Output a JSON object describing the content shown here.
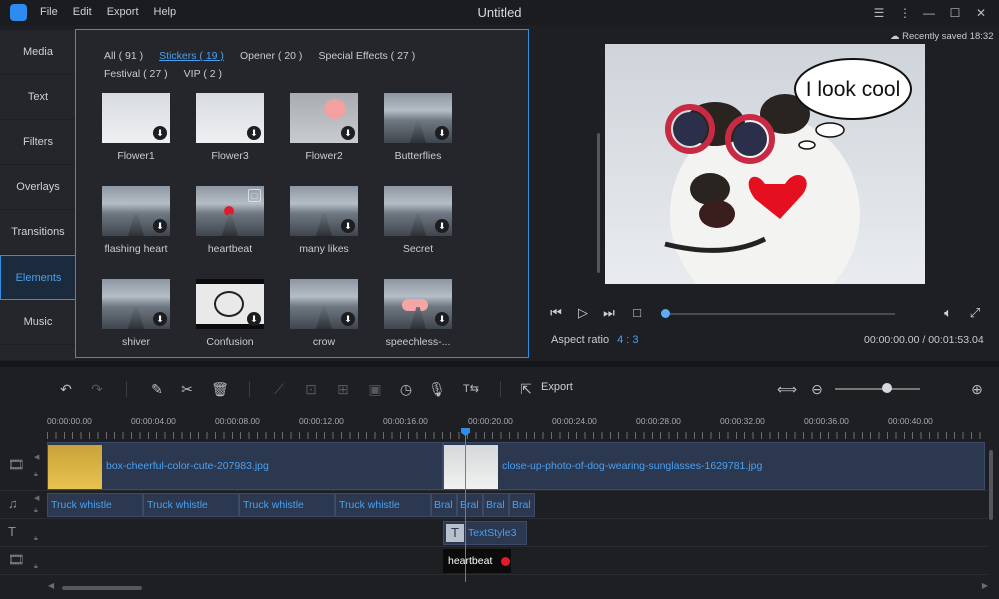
{
  "app": {
    "title": "Untitled",
    "menu": [
      "File",
      "Edit",
      "Export",
      "Help"
    ]
  },
  "sidebar": {
    "items": [
      {
        "label": "Media"
      },
      {
        "label": "Text"
      },
      {
        "label": "Filters"
      },
      {
        "label": "Overlays"
      },
      {
        "label": "Transitions"
      },
      {
        "label": "Elements"
      },
      {
        "label": "Music"
      }
    ],
    "active": "Elements"
  },
  "categories": [
    {
      "label": "All ( 91 )"
    },
    {
      "label": "Stickers ( 19 )"
    },
    {
      "label": "Opener ( 20 )"
    },
    {
      "label": "Special Effects ( 27 )"
    },
    {
      "label": "Festival ( 27 )"
    },
    {
      "label": "VIP ( 2 )"
    }
  ],
  "stickers": [
    {
      "label": "Flower1"
    },
    {
      "label": "Flower3"
    },
    {
      "label": "Flower2"
    },
    {
      "label": "Butterflies"
    },
    {
      "label": "flashing heart"
    },
    {
      "label": "heartbeat"
    },
    {
      "label": "many likes"
    },
    {
      "label": "Secret"
    },
    {
      "label": "shiver"
    },
    {
      "label": "Confusion"
    },
    {
      "label": "crow"
    },
    {
      "label": "speechless-..."
    }
  ],
  "preview": {
    "recently_saved": "Recently saved 18:32",
    "speech_text": "I look cool",
    "aspect_label": "Aspect ratio",
    "aspect_value": "4 : 3",
    "timecode": "00:00:00.00 / 00:01:53.04"
  },
  "toolbar": {
    "export_label": "Export"
  },
  "ruler": [
    "00:00:00.00",
    "00:00:04.00",
    "00:00:08.00",
    "00:00:12.00",
    "00:00:16.00",
    "00:00:20.00",
    "00:00:24.00",
    "00:00:28.00",
    "00:00:32.00",
    "00:00:36.00",
    "00:00:40.00"
  ],
  "timeline": {
    "video_clip1": "box-cheerful-color-cute-207983.jpg",
    "video_clip2": "close-up-photo-of-dog-wearing-sunglasses-1629781.jpg",
    "audio_clips": [
      "Truck whistle",
      "Truck whistle",
      "Truck whistle",
      "Truck whistle",
      "Bral",
      "Bral",
      "Bral",
      "Bral"
    ],
    "text_clip": "TextStyle3",
    "element_clip": "heartbeat"
  },
  "colors": {
    "accent": "#2f8fe6",
    "active_text": "#4aa0f0",
    "background": "#1e1f23"
  }
}
